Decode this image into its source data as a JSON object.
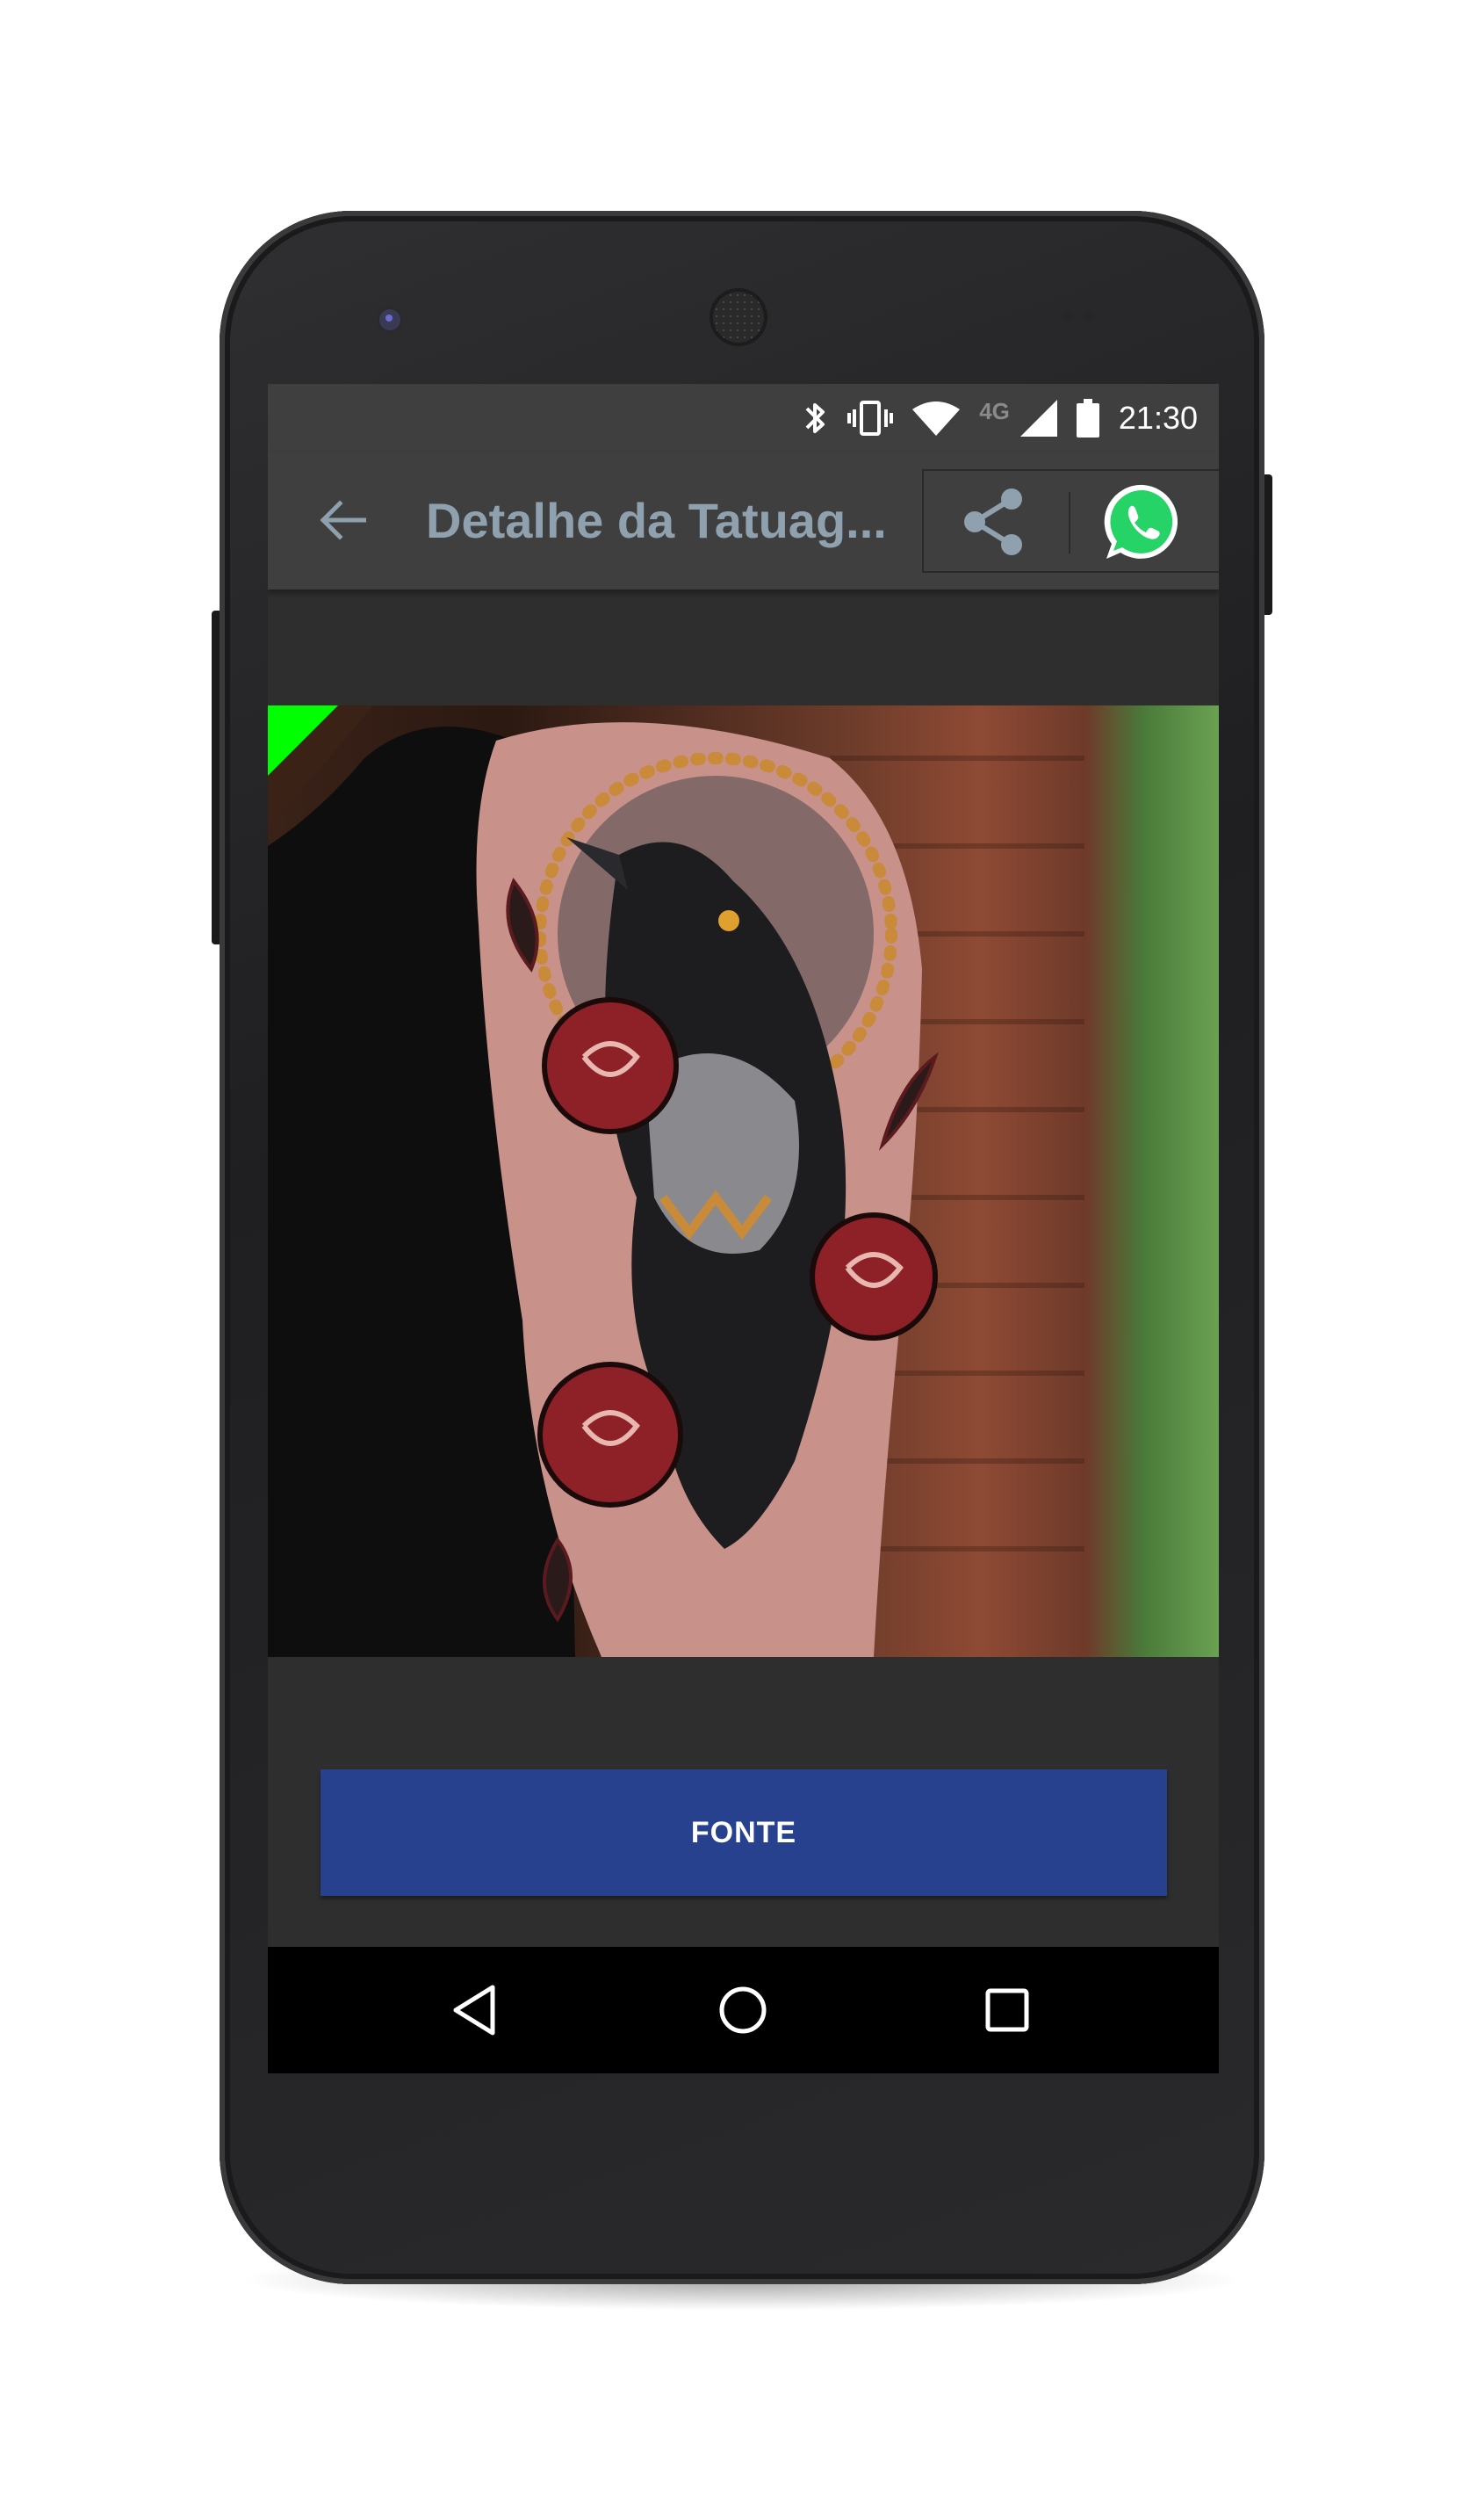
{
  "status_bar": {
    "network_label": "4G",
    "time": "21:30",
    "icons": [
      "bluetooth-icon",
      "vibrate-icon",
      "wifi-icon",
      "cellular-signal-icon",
      "battery-icon"
    ]
  },
  "toolbar": {
    "title": "Detalhe da Tatuag...",
    "back_icon": "arrow-back-icon",
    "share_icon": "share-icon",
    "whatsapp_icon": "whatsapp-icon"
  },
  "content": {
    "image_subject": "tattoo-photo",
    "button_label": "FONTE",
    "button_color": "#27418e"
  },
  "navigation_bar": {
    "icons": [
      "nav-back-icon",
      "nav-home-icon",
      "nav-recents-icon"
    ]
  },
  "colors": {
    "app_bar": "#3f3f3f",
    "background": "#2e2e2e",
    "title_text": "#8fa1ae",
    "whatsapp_green": "#25d366",
    "corner_badge": "#00ff00"
  }
}
